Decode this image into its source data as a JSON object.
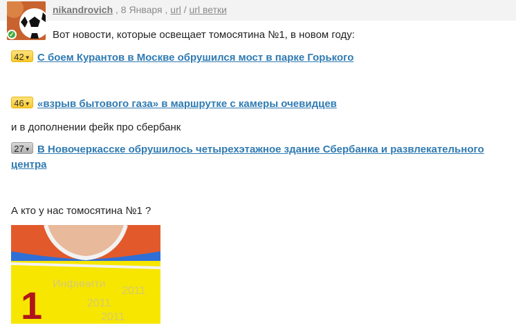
{
  "post": {
    "author": "nikandrovich",
    "date": ", 8 Января ,",
    "url_label": "url",
    "separator": "/",
    "url_thread_label": "url ветки",
    "intro": "Вот новости, которые освещает томосятина №1, в новом году:",
    "items": [
      {
        "count": "42",
        "title": "С боем Курантов в Москве обрушился мост в парке Горького"
      },
      {
        "count": "46",
        "title": "«взрыв бытового газа» в маршрутке с камеры очевидцев"
      },
      {
        "count": "27",
        "title": "В Новочеркасске обрушилось четырехэтажное здание Сбербанка и развлекательного центра"
      }
    ],
    "addition": "и в дополнении фейк про сбербанк",
    "question": "А кто у нас томосятина №1 ?",
    "photo_number": "1"
  }
}
